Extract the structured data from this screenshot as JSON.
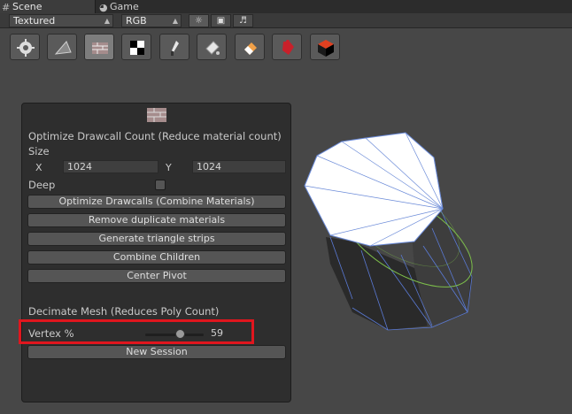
{
  "tabs": [
    {
      "label": "Scene",
      "icon": "grid-icon"
    },
    {
      "label": "Game",
      "icon": "pacman-icon"
    }
  ],
  "scene_toolbar": {
    "render_mode": "Textured",
    "color_mode": "RGB"
  },
  "tool_strip": [
    "settings-icon",
    "prism-icon",
    "brick-wall-icon",
    "checker-icon",
    "brush-icon",
    "fill-bucket-icon",
    "eraser-icon",
    "puzzle-piece-icon",
    "red-cube-icon"
  ],
  "panel": {
    "header_icon": "brick-wall-icon",
    "optimize_title": "Optimize Drawcall Count (Reduce material count)",
    "size_label": "Size",
    "x_label": "X",
    "x_value": "1024",
    "y_label": "Y",
    "y_value": "1024",
    "deep_label": "Deep",
    "deep_checked": false,
    "buttons": [
      "Optimize Drawcalls (Combine Materials)",
      "Remove duplicate materials",
      "Generate triangle strips",
      "Combine Children",
      "Center Pivot"
    ],
    "decimate_title": "Decimate Mesh (Reduces Poly Count)",
    "vertex_label": "Vertex %",
    "vertex_value": "59",
    "new_session": "New Session"
  },
  "colors": {
    "highlight": "#e0161e",
    "background": "#474747",
    "panel": "#2e2e2e"
  }
}
